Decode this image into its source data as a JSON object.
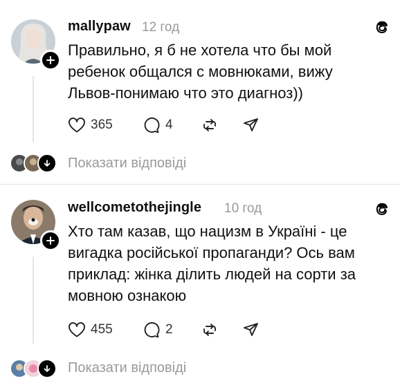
{
  "posts": [
    {
      "username": "mallypaw",
      "time": "12 год",
      "text_lines": [
        "Правильно, я б не хотела что бы мой",
        "ребенок общался с мовнюками, вижу",
        "Львов-понимаю что это диагноз))"
      ],
      "likes": "365",
      "comments": "4",
      "show_replies": "Показати відповіді",
      "avatar_icon": "avatar-user-photo",
      "colors": {
        "avatar_bg": "#c9d0d6"
      }
    },
    {
      "username": "wellcometothejingle",
      "time": "10 год",
      "text_lines": [
        "Хто там казав, що нацизм в Україні - це",
        "вигадка російської пропаганди? Ось вам",
        "приклад: жінка ділить людей на сорти за",
        "мовною ознакою"
      ],
      "likes": "455",
      "comments": "2",
      "show_replies": "Показати відповіді",
      "avatar_icon": "avatar-user-photo",
      "colors": {
        "avatar_bg": "#8a7a6a"
      }
    }
  ],
  "icons": [
    "threads-logo-icon",
    "heart-icon",
    "comment-icon",
    "repost-icon",
    "share-icon",
    "plus-icon",
    "chevron-down-icon"
  ],
  "colors": {
    "text": "#101010",
    "muted": "#999999",
    "accent": "#000000"
  }
}
